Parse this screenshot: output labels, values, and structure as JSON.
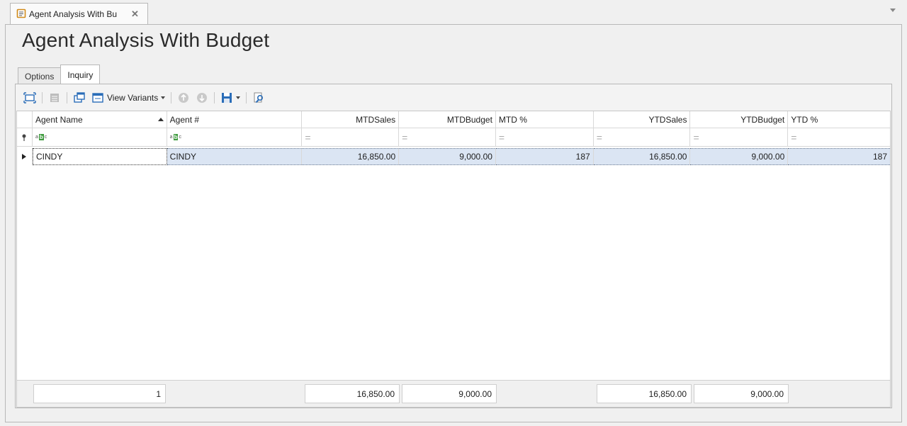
{
  "document_tab": {
    "label": "Agent Analysis With Bu",
    "close_icon": "close-icon"
  },
  "page": {
    "title": "Agent Analysis With Budget"
  },
  "inner_tabs": [
    {
      "label": "Options"
    },
    {
      "label": "Inquiry"
    }
  ],
  "toolbar": {
    "view_variants_label": "View Variants"
  },
  "grid": {
    "columns": [
      {
        "label": "Agent Name"
      },
      {
        "label": "Agent #"
      },
      {
        "label": "MTDSales"
      },
      {
        "label": "MTDBudget"
      },
      {
        "label": "MTD %"
      },
      {
        "label": "YTDSales"
      },
      {
        "label": "YTDBudget"
      },
      {
        "label": "YTD %"
      }
    ],
    "rows": [
      {
        "agent_name": "CINDY",
        "agent_no": "CINDY",
        "mtd_sales": "16,850.00",
        "mtd_budget": "9,000.00",
        "mtd_pct": "187",
        "ytd_sales": "16,850.00",
        "ytd_budget": "9,000.00",
        "ytd_pct": "187"
      }
    ],
    "footer": {
      "count": "1",
      "mtd_sales": "16,850.00",
      "mtd_budget": "9,000.00",
      "ytd_sales": "16,850.00",
      "ytd_budget": "9,000.00"
    }
  },
  "colors": {
    "selected_row": "#dbe5f3",
    "accent_green": "#3f9b3f"
  }
}
